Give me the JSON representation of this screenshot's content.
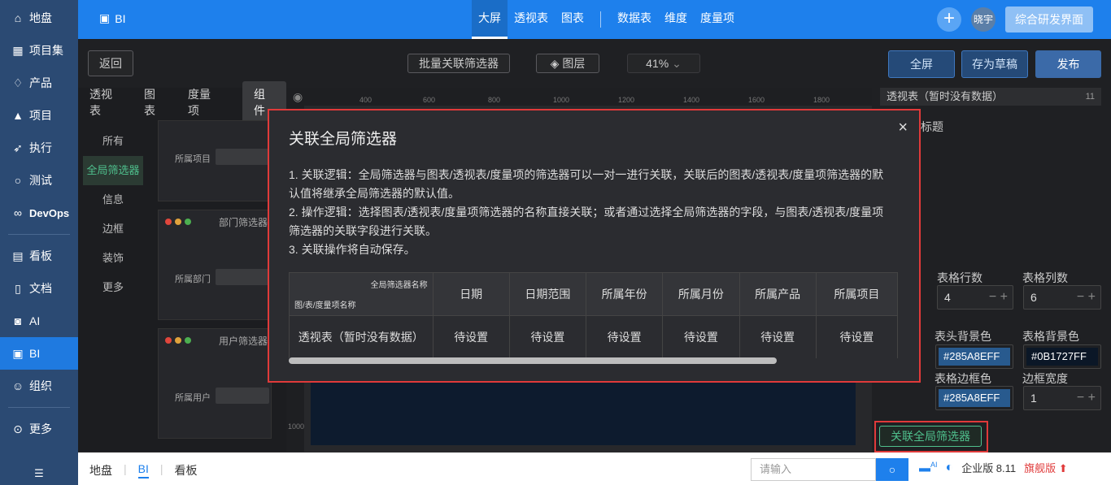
{
  "sidebar": {
    "items": [
      {
        "label": "地盘",
        "icon": "home-icon"
      },
      {
        "label": "项目集",
        "icon": "grid-icon"
      },
      {
        "label": "产品",
        "icon": "bulb-icon"
      },
      {
        "label": "项目",
        "icon": "rocket-icon"
      },
      {
        "label": "执行",
        "icon": "run-icon"
      },
      {
        "label": "测试",
        "icon": "search-icon"
      },
      {
        "label": "DevOps",
        "icon": "infinity-icon"
      },
      {
        "label": "看板",
        "icon": "board-icon"
      },
      {
        "label": "文档",
        "icon": "doc-icon"
      },
      {
        "label": "AI",
        "icon": "robot-icon"
      },
      {
        "label": "BI",
        "icon": "chart-icon"
      },
      {
        "label": "组织",
        "icon": "people-icon"
      },
      {
        "label": "更多",
        "icon": "more-icon"
      }
    ]
  },
  "topbar": {
    "app": "BI",
    "tabs": [
      "大屏",
      "透视表",
      "图表",
      "数据表",
      "维度",
      "度量项"
    ],
    "user": "晓宇",
    "button": "综合研发界面"
  },
  "editor": {
    "back": "返回",
    "batch": "批量关联筛选器",
    "layer": "图层",
    "zoom": "41%",
    "fullscreen": "全屏",
    "draft": "存为草稿",
    "publish": "发布"
  },
  "left_panel": {
    "tabs": [
      "透视表",
      "图表",
      "度量项",
      "组件"
    ],
    "categories": [
      "所有",
      "全局筛选器",
      "信息",
      "边框",
      "装饰",
      "更多"
    ],
    "cards": [
      {
        "title": "",
        "label": "所属项目"
      },
      {
        "title": "部门筛选器",
        "label": "所属部门"
      },
      {
        "title": "用户筛选器",
        "label": "所属用户"
      }
    ]
  },
  "ruler": {
    "ticks": [
      "400",
      "600",
      "800",
      "1000",
      "1200",
      "1400",
      "1600",
      "1800"
    ],
    "vtick": "1000"
  },
  "right_panel": {
    "selected": "透视表（暂时没有数据）",
    "selected_num": "11",
    "title_label": "标题",
    "rows_label": "表格行数",
    "cols_label": "表格列数",
    "rows": "4",
    "cols": "6",
    "head_bg_label": "表头背景色",
    "table_bg_label": "表格背景色",
    "head_bg": "#285A8EFF",
    "table_bg": "#0B1727FF",
    "border_color_label": "表格边框色",
    "border_width_label": "边框宽度",
    "border_color": "#285A8EFF",
    "border_width": "1",
    "assoc_button": "关联全局筛选器"
  },
  "modal": {
    "title": "关联全局筛选器",
    "close": "×",
    "p1": "1. 关联逻辑：全局筛选器与图表/透视表/度量项的筛选器可以一对一进行关联，关联后的图表/透视表/度量项筛选器的默认值将继承全局筛选器的默认值。",
    "p2": "2. 操作逻辑：选择图表/透视表/度量项筛选器的名称直接关联；或者通过选择全局筛选器的字段，与图表/透视表/度量项筛选器的关联字段进行关联。",
    "p3": "3. 关联操作将自动保存。",
    "corner_top": "全局筛选器名称",
    "corner_bottom": "图/表/度量项名称",
    "columns": [
      "日期",
      "日期范围",
      "所属年份",
      "所属月份",
      "所属产品",
      "所属项目"
    ],
    "row_name": "透视表（暂时没有数据）",
    "row_values": [
      "待设置",
      "待设置",
      "待设置",
      "待设置",
      "待设置",
      "待设置"
    ]
  },
  "bottombar": {
    "tabs": [
      "地盘",
      "BI",
      "看板"
    ],
    "search_placeholder": "请输入",
    "ai": "AI",
    "version": "企业版 8.11",
    "flagship": "旗舰版"
  },
  "colors": {
    "accent": "#1e80ec",
    "sidebar": "#2b4a73",
    "highlight": "#e03a3a",
    "green": "#4fc08d"
  }
}
